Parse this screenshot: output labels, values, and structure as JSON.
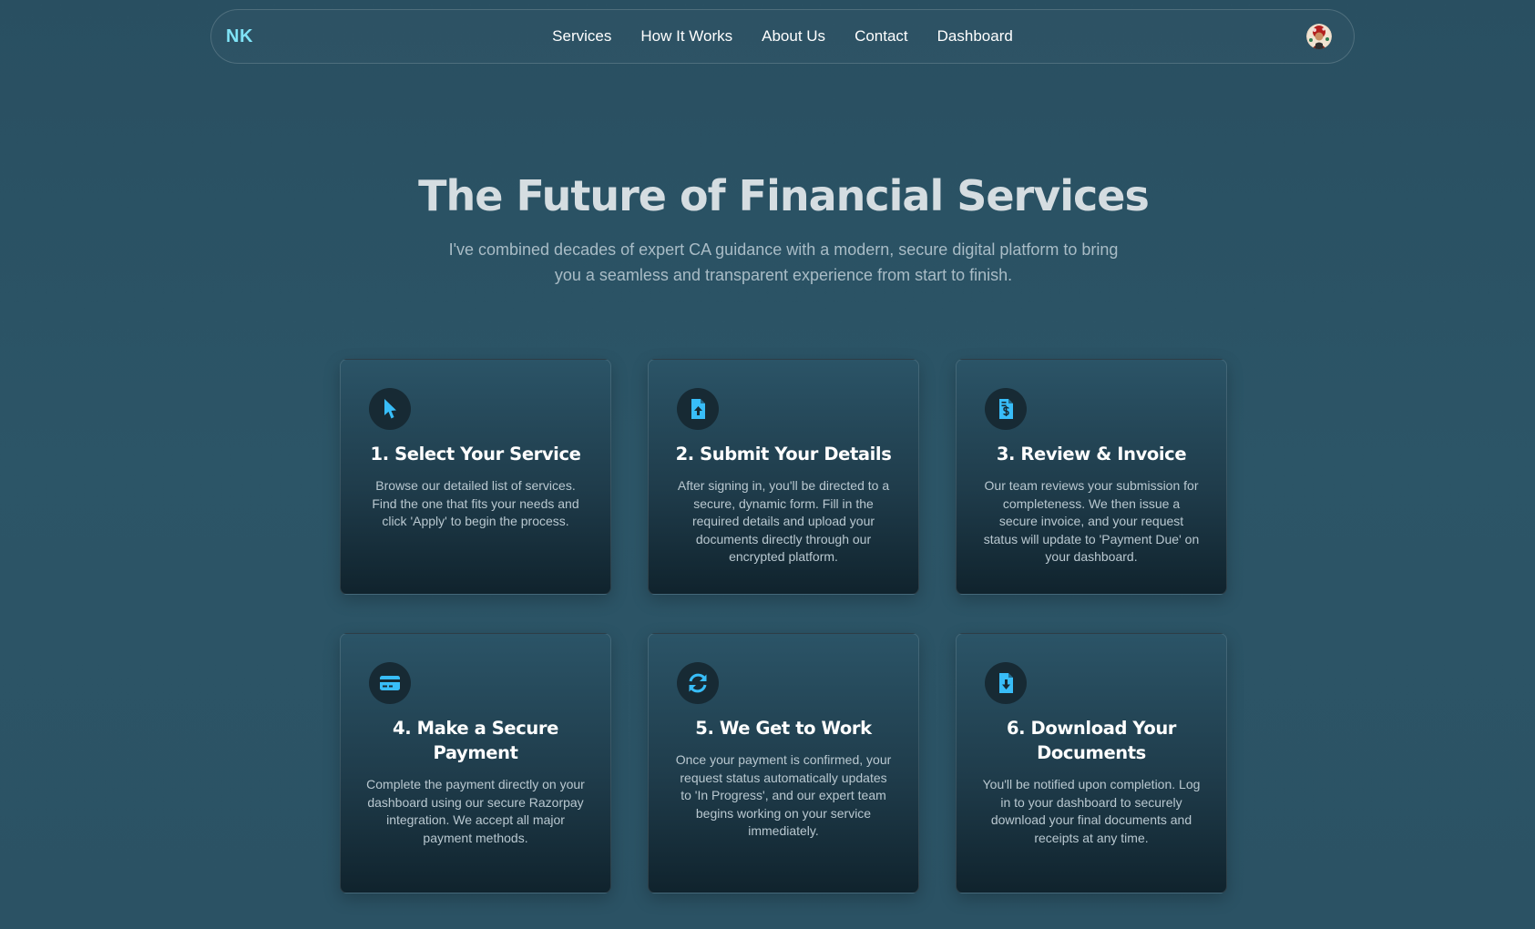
{
  "nav": {
    "brand": "NK",
    "links": [
      "Services",
      "How It Works",
      "About Us",
      "Contact",
      "Dashboard"
    ]
  },
  "hero": {
    "title": "The Future of Financial Services",
    "subtitle": "I've combined decades of expert CA guidance with a modern, secure digital platform to bring you a seamless and transparent experience from start to finish."
  },
  "steps": [
    {
      "icon": "cursor-arrow-icon",
      "title": "1. Select Your Service",
      "description": "Browse our detailed list of services. Find the one that fits your needs and click 'Apply' to begin the process."
    },
    {
      "icon": "file-upload-icon",
      "title": "2. Submit Your Details",
      "description": "After signing in, you'll be directed to a secure, dynamic form. Fill in the required details and upload your documents directly through our encrypted platform."
    },
    {
      "icon": "invoice-dollar-icon",
      "title": "3. Review & Invoice",
      "description": "Our team reviews your submission for completeness. We then issue a secure invoice, and your request status will update to 'Payment Due' on your dashboard."
    },
    {
      "icon": "credit-card-icon",
      "title": "4. Make a Secure Payment",
      "description": "Complete the payment directly on your dashboard using our secure Razorpay integration. We accept all major payment methods."
    },
    {
      "icon": "refresh-sync-icon",
      "title": "5. We Get to Work",
      "description": "Once your payment is confirmed, your request status automatically updates to 'In Progress', and our expert team begins working on your service immediately."
    },
    {
      "icon": "file-download-icon",
      "title": "6. Download Your Documents",
      "description": "You'll be notified upon completion. Log in to your dashboard to securely download your final documents and receipts at any time."
    }
  ],
  "colors": {
    "background": "#2c5567",
    "brand": "#7fe3f6",
    "icon_accent": "#38bdf8",
    "icon_circle": "#172a34"
  }
}
